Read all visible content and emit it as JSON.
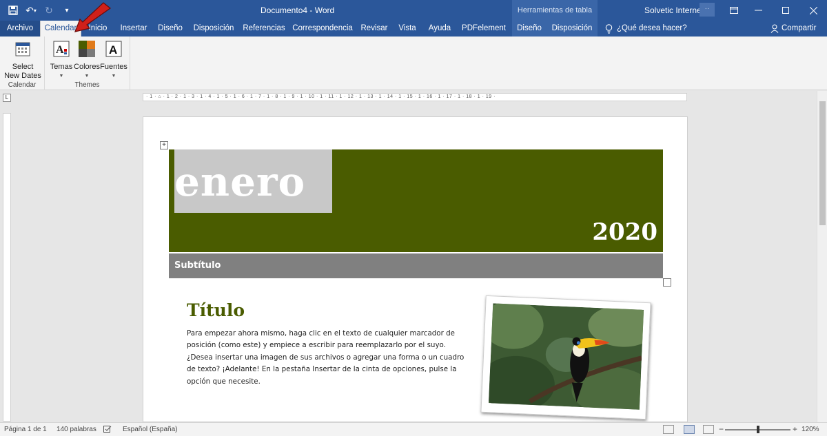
{
  "window": {
    "title": "Documento4  -  Word",
    "contextual_header": "Herramientas de tabla",
    "account_name": "Solvetic Internet",
    "account_initials": "··"
  },
  "tabs": {
    "archivo": "Archivo",
    "calendar": "Calendar",
    "inicio": "Inicio",
    "insertar": "Insertar",
    "diseno": "Diseño",
    "disposicion": "Disposición",
    "referencias": "Referencias",
    "correspondencia": "Correspondencia",
    "revisar": "Revisar",
    "vista": "Vista",
    "ayuda": "Ayuda",
    "pdfelement": "PDFelement",
    "tool_diseno": "Diseño",
    "tool_disposicion": "Disposición",
    "tell_me": "¿Qué desea hacer?",
    "share": "Compartir"
  },
  "ribbon": {
    "calendar_group": {
      "label": "Calendar",
      "select_dates_line1": "Select",
      "select_dates_line2": "New Dates"
    },
    "themes_group": {
      "label": "Themes",
      "temas": "Temas",
      "colores": "Colores",
      "fuentes": "Fuentes"
    }
  },
  "ruler": {
    "marks": "· 1 · ⌂ · 1 · 2 · 1 · 3 · 1 · 4 · 1 · 5 · 1 · 6 · 1 · 7 · 1 · 8 · 1 · 9 · 1 · 10 · 1 · 11 · 1 · 12 · 1 · 13 · 1 · 14 · 1 · 15 · 1 · 16 · 1 · 17 · 1 · 18 · 1 · 19 ·"
  },
  "document": {
    "month": "enero",
    "year": "2020",
    "subtitle": "Subtítulo",
    "heading": "Título",
    "body": "Para empezar ahora mismo, haga clic en el texto de cualquier marcador de posición (como este) y empiece a escribir para reemplazarlo por el suyo. ¿Desea insertar una imagen de sus archivos o agregar una forma o un cuadro de texto? ¡Adelante! En la pestaña Insertar de la cinta de opciones, pulse la opción que necesite."
  },
  "status": {
    "page": "Página 1 de 1",
    "words": "140 palabras",
    "language": "Español (España)",
    "zoom": "120%",
    "zoom_minus": "−",
    "zoom_plus": "+"
  },
  "colors": {
    "title_bar": "#2b579a",
    "banner": "#4a5c00",
    "subtitle_bar": "#808080",
    "annotation_arrow": "#d0201a"
  }
}
